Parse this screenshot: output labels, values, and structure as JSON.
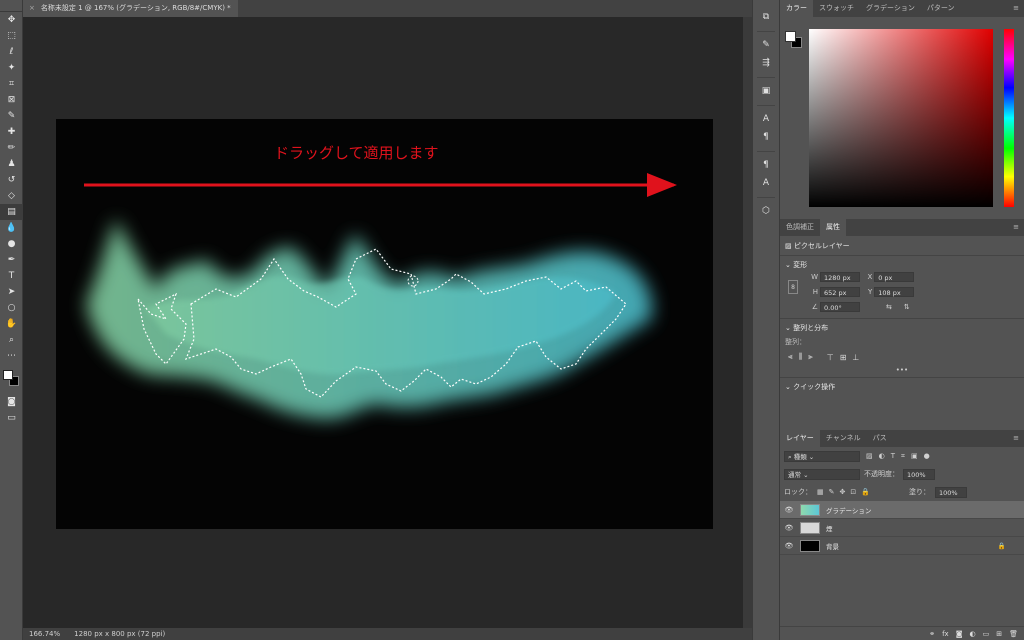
{
  "document": {
    "tab_title": "名称未設定 1 @ 167% (グラデーション, RGB/8#/CMYK) *",
    "close_glyph": "×",
    "canvas_annotation": "ドラッグして適用します",
    "zoom": "166.74%",
    "doc_info": "1280 px x 800 px (72 ppi)"
  },
  "tools": [
    "move-tool",
    "marquee-tool",
    "lasso-tool",
    "magic-wand-tool",
    "crop-tool",
    "frame-tool",
    "eyedropper-tool",
    "healing-brush-tool",
    "brush-tool",
    "clone-stamp-tool",
    "history-brush-tool",
    "eraser-tool",
    "gradient-tool",
    "blur-tool",
    "dodge-tool",
    "pen-tool",
    "type-tool",
    "path-selection-tool",
    "shape-tool",
    "hand-tool",
    "zoom-tool",
    "more-tools"
  ],
  "color_panel": {
    "tabs": [
      "カラー",
      "スウォッチ",
      "グラデーション",
      "パターン"
    ],
    "menu_glyph": "≡"
  },
  "props_panel": {
    "tabs": [
      "色調補正",
      "属性"
    ],
    "layer_kind": "ピクセルレイヤー",
    "transform_header": "変形",
    "w_label": "W",
    "w_value": "1280 px",
    "x_label": "X",
    "x_value": "0 px",
    "h_label": "H",
    "h_value": "652 px",
    "y_label": "Y",
    "y_value": "108 px",
    "angle_value": "0.00°",
    "align_header": "整列と分布",
    "align_label": "整列：",
    "more_glyph": "•••",
    "quick_header": "クイック操作"
  },
  "layers_panel": {
    "tabs": [
      "レイヤー",
      "チャンネル",
      "パス"
    ],
    "filter_kind": "種類",
    "blend_mode": "通常",
    "opacity_label": "不透明度：",
    "opacity_value": "100%",
    "lock_label": "ロック：",
    "fill_label": "塗り：",
    "fill_value": "100%",
    "layers": [
      {
        "name": "グラデーション",
        "thumb": "gradient",
        "active": true,
        "locked": false
      },
      {
        "name": "煙",
        "thumb": "smoke",
        "active": false,
        "locked": false
      },
      {
        "name": "背景",
        "thumb": "black",
        "active": false,
        "locked": true
      }
    ],
    "footer_icons": [
      "link-icon",
      "fx-icon",
      "mask-icon",
      "adjustment-icon",
      "folder-icon",
      "new-layer-icon",
      "trash-icon"
    ]
  },
  "colors": {
    "app_bg": "#535353",
    "canvas_bg": "#040404",
    "annotation_red": "#e0121c",
    "smoke_left": "#86d4a4",
    "smoke_right": "#4ec3d2"
  }
}
